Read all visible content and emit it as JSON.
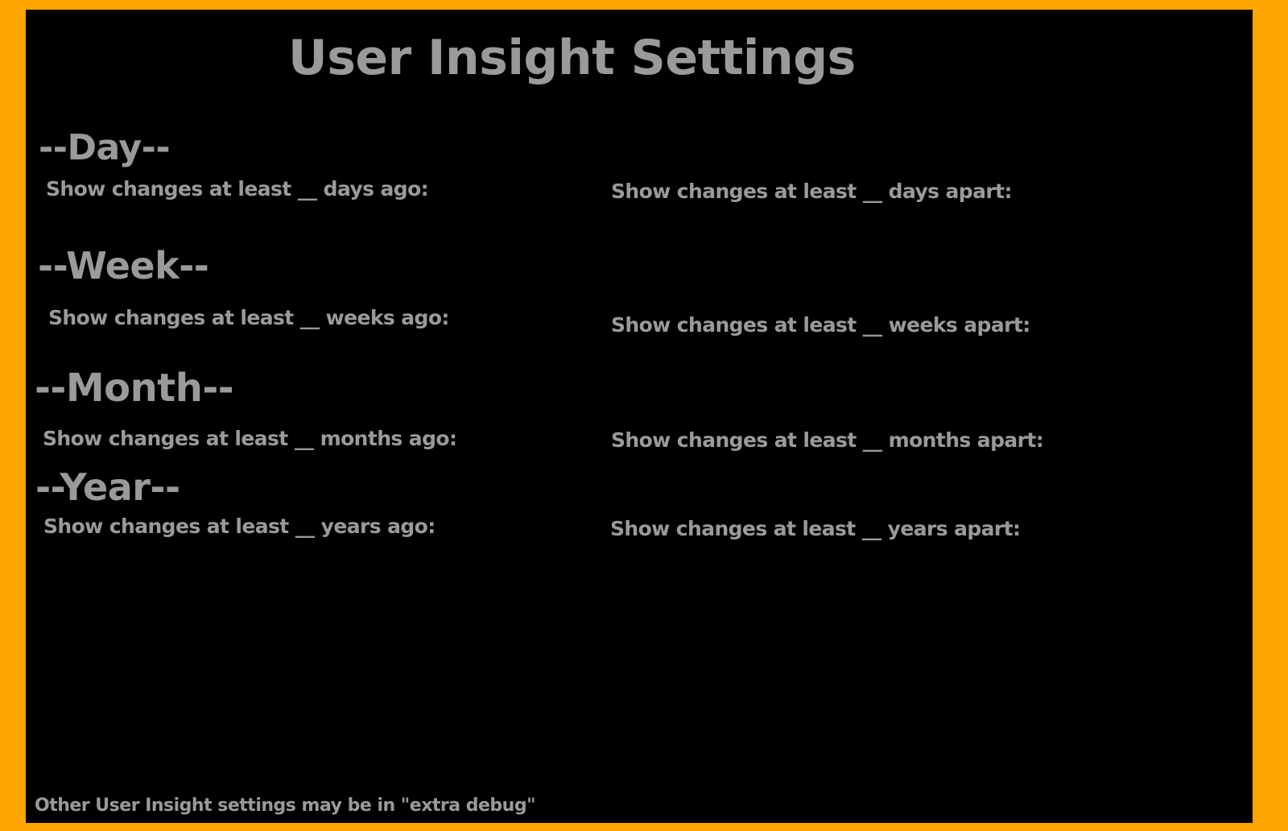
{
  "colors": {
    "frame": "#FFA500",
    "panel_background": "#000000",
    "text": "#9a9a9a"
  },
  "page": {
    "title": "User Insight Settings",
    "footer_note": "Other User Insight settings may be in \"extra debug\""
  },
  "sections": {
    "day": {
      "heading": "--Day--",
      "ago_label": "Show changes at least __ days ago:",
      "apart_label": "Show changes at least __ days apart:"
    },
    "week": {
      "heading": "--Week--",
      "ago_label": "Show changes at least __ weeks ago:",
      "apart_label": "Show changes at least __ weeks apart:"
    },
    "month": {
      "heading": "--Month--",
      "ago_label": "Show changes at least __ months ago:",
      "apart_label": "Show changes at least __ months apart:"
    },
    "year": {
      "heading": "--Year--",
      "ago_label": "Show changes at least __ years ago:",
      "apart_label": "Show changes at least __ years apart:"
    }
  }
}
